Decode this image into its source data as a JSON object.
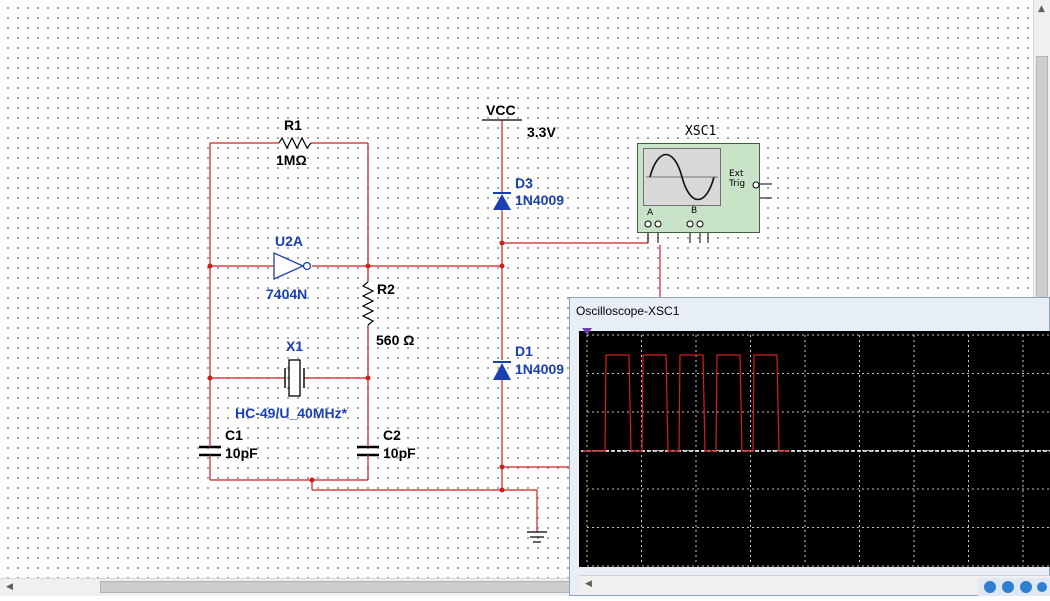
{
  "schematic": {
    "vcc": {
      "label": "VCC",
      "value": "3.3V"
    },
    "r1": {
      "ref": "R1",
      "value": "1MΩ"
    },
    "u2a": {
      "ref": "U2A",
      "value": "7404N"
    },
    "r2": {
      "ref": "R2",
      "value": "560 Ω"
    },
    "x1": {
      "ref": "X1",
      "value": "HC-49/U_40MHz*"
    },
    "c1": {
      "ref": "C1",
      "value": "10pF"
    },
    "c2": {
      "ref": "C2",
      "value": "10pF"
    },
    "d3": {
      "ref": "D3",
      "value": "1N4009"
    },
    "d1": {
      "ref": "D1",
      "value": "1N4009"
    },
    "xsc1": {
      "ref": "XSC1",
      "ext_trig": "Ext Trig",
      "pin_a": "A",
      "pin_b": "B"
    }
  },
  "colors": {
    "wire": "#cc2020",
    "component": "#1a3fb0",
    "scope_grid": "#ffffff",
    "scope_trace": "#d81e1e"
  },
  "scope_window": {
    "title": "Oscilloscope-XSC1",
    "trace_pulses": 5
  }
}
